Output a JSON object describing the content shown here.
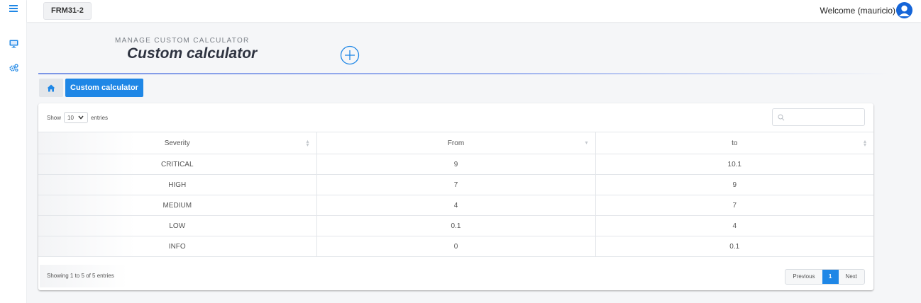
{
  "topbar": {
    "project": "FRM31-2",
    "welcome": "Welcome (mauricio)"
  },
  "sidebar": {
    "icons": [
      "menu-icon",
      "monitor-icon",
      "cogs-icon"
    ]
  },
  "header": {
    "subtitle": "MANAGE CUSTOM CALCULATOR",
    "title": "Custom calculator"
  },
  "breadcrumb": {
    "home_icon": "home-icon",
    "current": "Custom calculator"
  },
  "table_controls": {
    "show_label": "Show",
    "page_length": "10",
    "entries_label": "entries",
    "search_value": ""
  },
  "table": {
    "columns": [
      "Severity",
      "From",
      "to"
    ],
    "rows": [
      [
        "CRITICAL",
        "9",
        "10.1"
      ],
      [
        "HIGH",
        "7",
        "9"
      ],
      [
        "MEDIUM",
        "4",
        "7"
      ],
      [
        "LOW",
        "0.1",
        "4"
      ],
      [
        "INFO",
        "0",
        "0.1"
      ]
    ]
  },
  "footer": {
    "info": "Showing 1 to 5 of 5 entries",
    "previous": "Previous",
    "page": "1",
    "next": "Next"
  },
  "colors": {
    "accent": "#1f87e6",
    "avatar": "#1565d8"
  }
}
